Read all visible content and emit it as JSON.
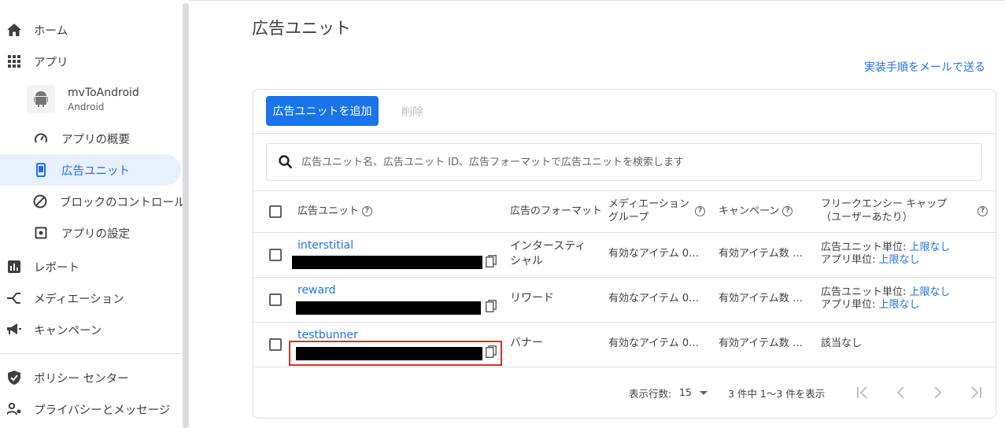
{
  "sidebar": {
    "home": "ホーム",
    "apps": "アプリ",
    "app": {
      "name": "mvToAndroid",
      "platform": "Android"
    },
    "sub_items": [
      {
        "label": "アプリの概要",
        "icon": "speedometer-icon"
      },
      {
        "label": "広告ユニット",
        "icon": "phone-icon",
        "active": true
      },
      {
        "label": "ブロックのコントロール",
        "icon": "block-icon"
      },
      {
        "label": "アプリの設定",
        "icon": "settings-icon"
      }
    ],
    "reports": "レポート",
    "mediation": "メディエーション",
    "campaigns": "キャンペーン",
    "policy_center": "ポリシー センター",
    "privacy": "プライバシーとメッセージ"
  },
  "page": {
    "title": "広告ユニット",
    "email_link": "実装手順をメールで送る"
  },
  "toolbar": {
    "add_label": "広告ユニットを追加",
    "delete_label": "削除"
  },
  "search": {
    "placeholder": "広告ユニット名、広告ユニット ID、広告フォーマットで広告ユニットを検索します"
  },
  "table": {
    "headers": {
      "unit": "広告ユニット",
      "format": "広告のフォーマット",
      "mediation_line1": "メディエーション",
      "mediation_line2": "グループ",
      "campaign": "キャンペーン",
      "freq_line1": "フリークエンシー キャップ",
      "freq_line2": "（ユーザーあたり）"
    },
    "rows": [
      {
        "name": "interstitial",
        "format_line1": "インタースティ",
        "format_line2": "シャル",
        "mediation": "有効なアイテム 0…",
        "campaign": "有効アイテム数 …",
        "freq_line1_label": "広告ユニット単位: ",
        "freq_line1_value": "上限なし",
        "freq_line2_label": "アプリ単位: ",
        "freq_line2_value": "上限なし"
      },
      {
        "name": "reward",
        "format_line1": "リワード",
        "mediation": "有効なアイテム 0…",
        "campaign": "有効アイテム数 …",
        "freq_line1_label": "広告ユニット単位: ",
        "freq_line1_value": "上限なし",
        "freq_line2_label": "アプリ単位: ",
        "freq_line2_value": "上限なし"
      },
      {
        "name": "testbunner",
        "format_line1": "バナー",
        "mediation": "有効なアイテム 0…",
        "campaign": "有効アイテム数 …",
        "freq_plain": "該当なし"
      }
    ]
  },
  "footer": {
    "rows_per_page_label": "表示行数:",
    "rows_per_page_value": "15",
    "range_text": "3 件中 1～3 件を表示"
  }
}
